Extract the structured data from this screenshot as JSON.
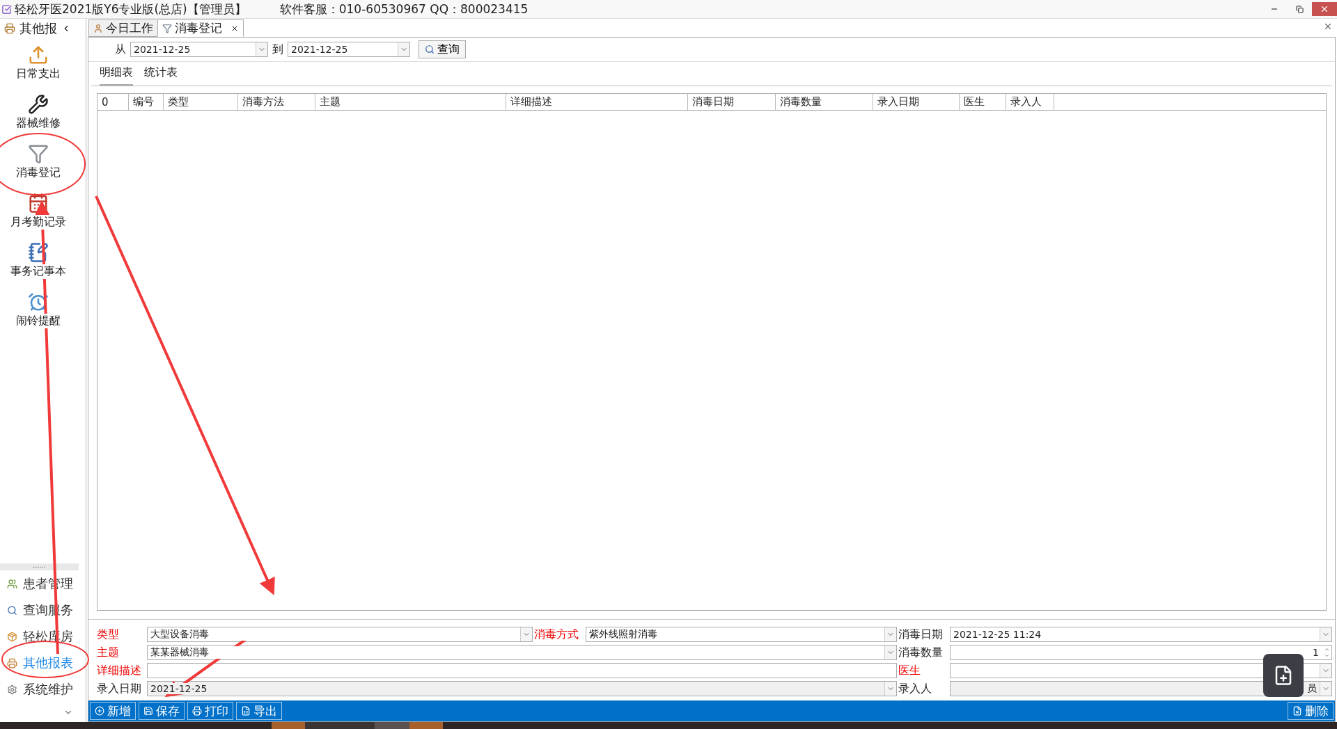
{
  "window": {
    "title": "轻松牙医2021版Y6专业版(总店)【管理员】",
    "support": "软件客服：010-60530967 QQ：800023415"
  },
  "sidebar": {
    "header": "其他报",
    "apps": [
      {
        "label": "日常支出"
      },
      {
        "label": "器械维修"
      },
      {
        "label": "消毒登记"
      },
      {
        "label": "月考勤记录"
      },
      {
        "label": "事务记事本"
      },
      {
        "label": "闹铃提醒"
      }
    ],
    "more": "......",
    "nav": [
      {
        "label": "患者管理",
        "selected": false
      },
      {
        "label": "查询服务",
        "selected": false
      },
      {
        "label": "轻松库房",
        "selected": false
      },
      {
        "label": "其他报表",
        "selected": true
      },
      {
        "label": "系统维护",
        "selected": false
      }
    ]
  },
  "tabs": [
    {
      "label": "今日工作",
      "selected": false,
      "closable": false
    },
    {
      "label": "消毒登记",
      "selected": true,
      "closable": true
    }
  ],
  "filter": {
    "from_label": "从",
    "from": "2021-12-25",
    "to_label": "到",
    "to": "2021-12-25",
    "query": "查询"
  },
  "subtabs": [
    {
      "label": "明细表",
      "selected": true
    },
    {
      "label": "统计表",
      "selected": false
    }
  ],
  "table": {
    "columns": [
      "0",
      "编号",
      "类型",
      "消毒方法",
      "主题",
      "详细描述",
      "消毒日期",
      "消毒数量",
      "录入日期",
      "医生",
      "录入人"
    ]
  },
  "form": [
    [
      {
        "label": "类型",
        "required": true,
        "kind": "select",
        "value": "大型设备消毒",
        "disabled": false
      },
      {
        "label": "消毒方式",
        "required": true,
        "kind": "select",
        "value": "紫外线照射消毒",
        "disabled": false
      },
      {
        "label": "消毒日期",
        "required": false,
        "kind": "select",
        "value": "2021-12-25 11:24",
        "disabled": false
      }
    ],
    [
      {
        "label": "主题",
        "required": true,
        "kind": "select",
        "value": "某某器械消毒",
        "wide": true,
        "disabled": false
      },
      {
        "label": "消毒数量",
        "required": false,
        "kind": "spin",
        "value": "1",
        "disabled": false
      }
    ],
    [
      {
        "label": "详细描述",
        "required": true,
        "kind": "text",
        "wide": true,
        "disabled": false
      },
      {
        "label": "医生",
        "required": true,
        "kind": "select",
        "disabled": false
      }
    ],
    [
      {
        "label": "录入日期",
        "required": false,
        "kind": "select",
        "value": "2021-12-25",
        "wide": true,
        "disabled": true
      },
      {
        "label": "录入人",
        "required": false,
        "kind": "select",
        "value": "员",
        "disabled": true
      }
    ]
  ],
  "toolbar": {
    "left": [
      "新增",
      "保存",
      "打印",
      "导出"
    ],
    "right": [
      "删除"
    ]
  }
}
